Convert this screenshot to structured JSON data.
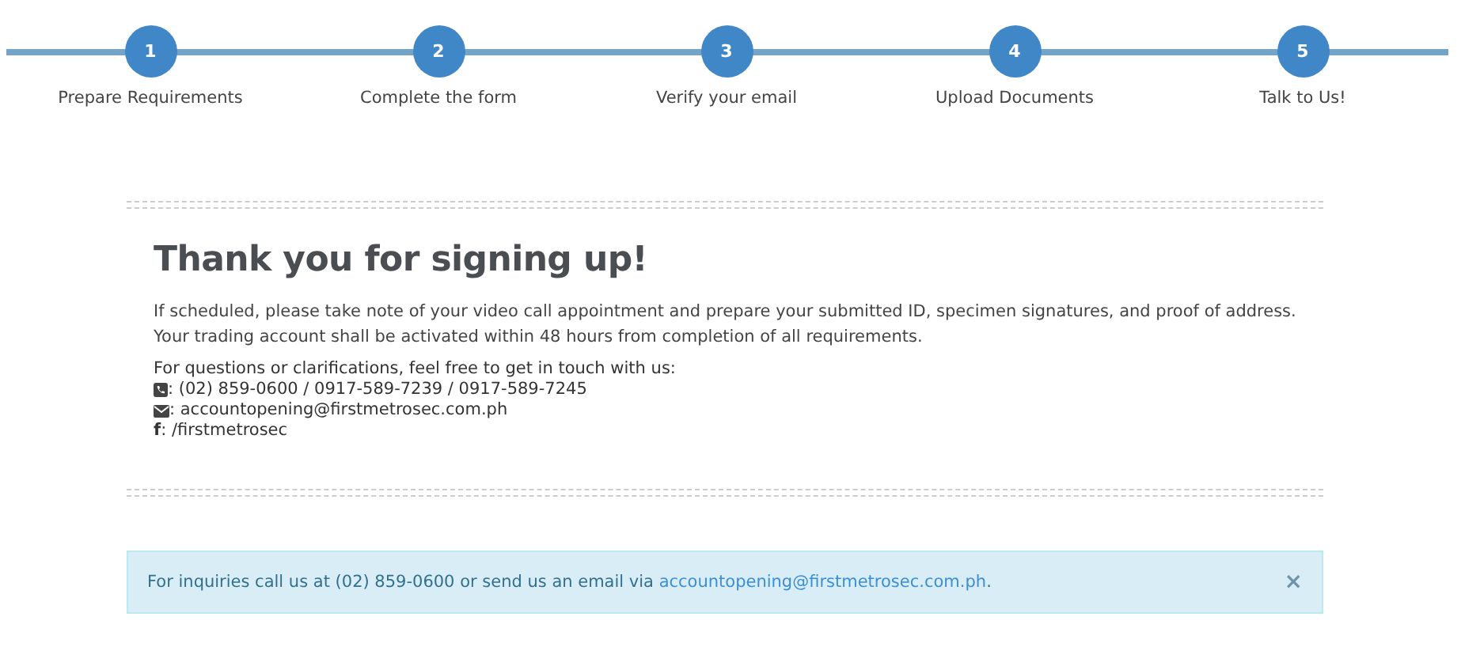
{
  "steps": [
    {
      "number": "1",
      "label": "Prepare Requirements"
    },
    {
      "number": "2",
      "label": "Complete the form"
    },
    {
      "number": "3",
      "label": "Verify your email"
    },
    {
      "number": "4",
      "label": "Upload Documents"
    },
    {
      "number": "5",
      "label": "Talk to Us!"
    }
  ],
  "confirmation": {
    "heading": "Thank you for signing up!",
    "message": "If scheduled, please take note of your video call appointment and prepare your submitted ID, specimen signatures, and proof of address. Your trading account shall be activated within 48 hours from completion of all requirements.",
    "contact_intro": "For questions or clarifications, feel free to get in touch with us:",
    "contacts": [
      {
        "kind": "phone",
        "text": ": (02) 859-0600 / 0917-589-7239 / 0917-589-7245"
      },
      {
        "kind": "email",
        "text": ": accountopening@firstmetrosec.com.ph"
      },
      {
        "kind": "facebook",
        "glyph": "f",
        "text": ": /firstmetrosec"
      }
    ]
  },
  "alert": {
    "text_before": "For inquiries call us at (02) 859-0600 or send us an email via ",
    "link": "accountopening@firstmetrosec.com.ph",
    "text_after": ".",
    "close": "×"
  }
}
